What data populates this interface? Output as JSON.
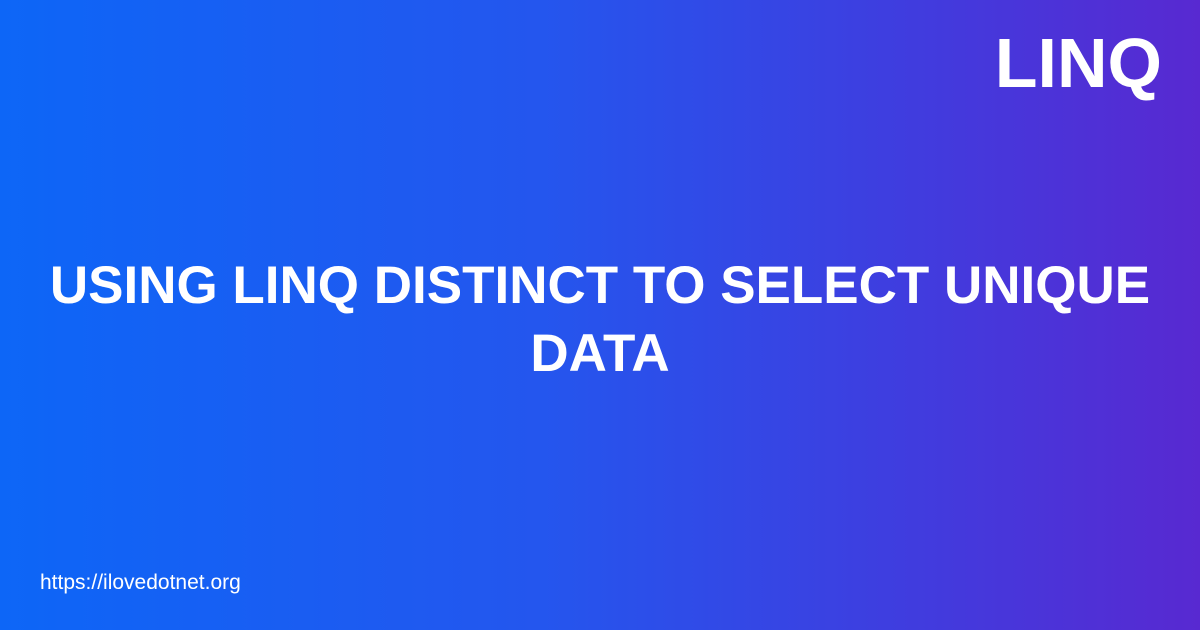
{
  "category": "LINQ",
  "title": "USING LINQ DISTINCT TO SELECT UNIQUE\nDATA",
  "site_url": "https://ilovedotnet.org",
  "colors": {
    "gradient_start": "#0d66f7",
    "gradient_end": "#5829d1",
    "text": "#ffffff"
  }
}
